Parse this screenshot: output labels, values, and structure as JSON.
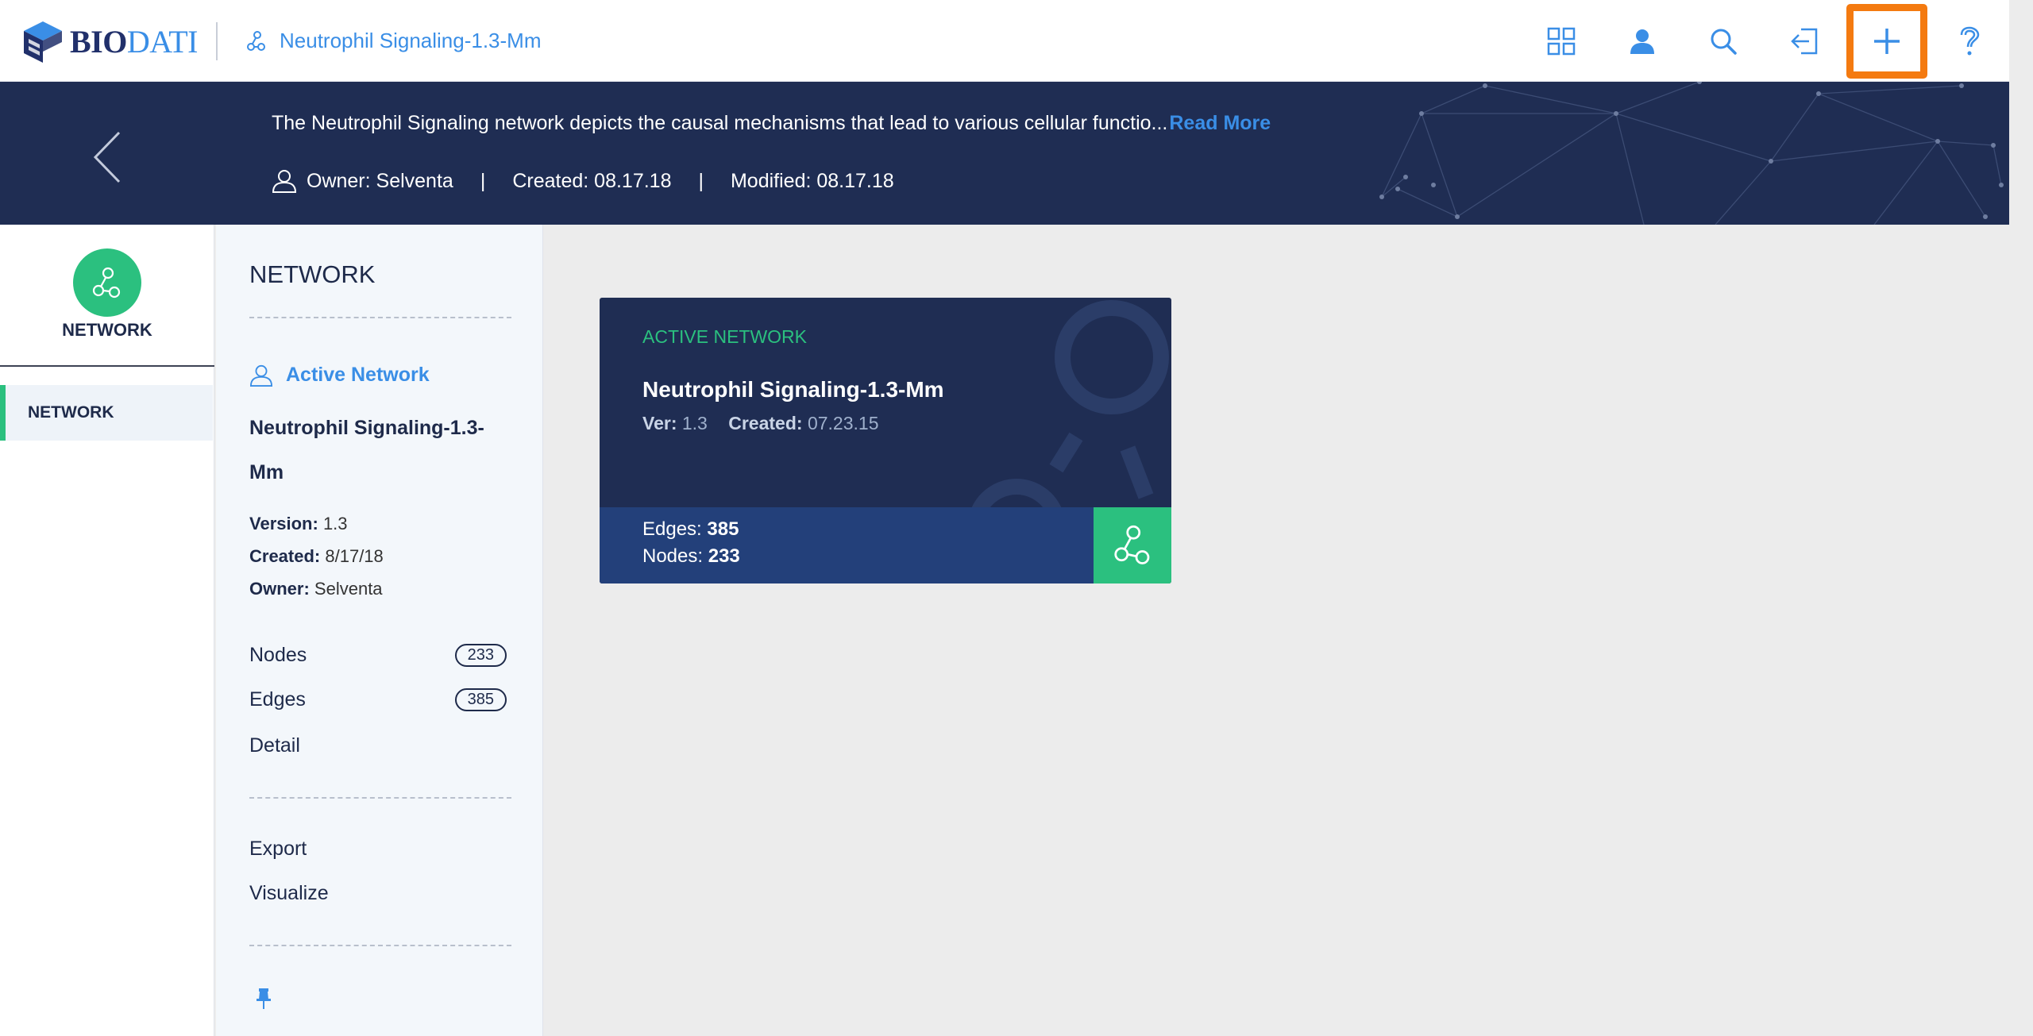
{
  "header": {
    "logo": {
      "bio": "BIO",
      "dati": "DATI"
    },
    "breadcrumb": "Neutrophil Signaling-1.3-Mm",
    "icons": [
      "grid-icon",
      "user-icon",
      "search-icon",
      "exit-icon",
      "plus-icon",
      "help-icon"
    ]
  },
  "banner": {
    "description": "The Neutrophil Signaling network depicts the causal mechanisms that lead to various cellular functio...",
    "read_more": "Read More",
    "owner": "Owner: Selventa",
    "separator": "|",
    "created": "Created: 08.17.18",
    "modified": "Modified: 08.17.18"
  },
  "left_nav": {
    "title": "NETWORK",
    "items": [
      {
        "label": "NETWORK",
        "active": true
      }
    ]
  },
  "detail": {
    "heading": "NETWORK",
    "active_link": "Active Network",
    "network_name": "Neutrophil Signaling-1.3-Mm",
    "version_label": "Version:",
    "version": "1.3",
    "created_label": "Created:",
    "created": "8/17/18",
    "owner_label": "Owner:",
    "owner": "Selventa",
    "nodes_label": "Nodes",
    "nodes": "233",
    "edges_label": "Edges",
    "edges": "385",
    "detail_link": "Detail",
    "export_link": "Export",
    "visualize_link": "Visualize"
  },
  "card": {
    "label": "ACTIVE NETWORK",
    "title": "Neutrophil Signaling-1.3-Mm",
    "ver_label": "Ver:",
    "ver": "1.3",
    "created_label": "Created:",
    "created": "07.23.15",
    "edges_label": "Edges:",
    "edges": "385",
    "nodes_label": "Nodes:",
    "nodes": "233"
  },
  "colors": {
    "navy": "#1f2d53",
    "accent_blue": "#3a8ee6",
    "green": "#2bc07f",
    "highlight": "#f47a10"
  }
}
